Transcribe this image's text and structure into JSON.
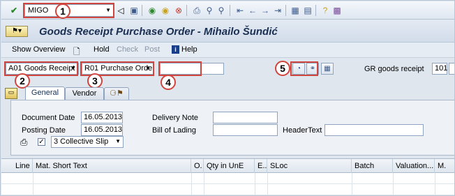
{
  "toolbar": {
    "command_value": "MIGO",
    "icons": [
      "check-icon",
      "save-icon",
      "back-icon",
      "exit-icon",
      "cancel-icon",
      "print-icon",
      "find-icon",
      "find-next-icon",
      "first-page-icon",
      "prev-page-icon",
      "next-page-icon",
      "last-page-icon",
      "new-session-icon",
      "shortcut-icon",
      "help-icon",
      "layout-icon"
    ]
  },
  "title": "Goods Receipt Purchase Order - Mihailo Šundić",
  "app_toolbar": {
    "show_overview": "Show Overview",
    "hold": "Hold",
    "check": "Check",
    "post": "Post",
    "help": "Help"
  },
  "header": {
    "action": "A01 Goods Receipt",
    "reference": "R01 Purchase Order",
    "po_number": "",
    "movement_label": "GR goods receipt",
    "movement_type": "101"
  },
  "annotations": [
    "1",
    "2",
    "3",
    "4",
    "5"
  ],
  "tabs": [
    "General",
    "Vendor"
  ],
  "general": {
    "document_date_label": "Document Date",
    "document_date": "16.05.2013",
    "posting_date_label": "Posting Date",
    "posting_date": "16.05.2013",
    "delivery_note_label": "Delivery Note",
    "delivery_note": "",
    "bill_of_lading_label": "Bill of Lading",
    "bill_of_lading": "",
    "header_text_label": "HeaderText",
    "header_text": "",
    "slip_checked": true,
    "slip_option": "3 Collective Slip"
  },
  "table": {
    "columns": [
      "Line",
      "Mat. Short Text",
      "O.",
      "Qty in UnE",
      "E..",
      "SLoc",
      "Batch",
      "Valuation...",
      "M."
    ]
  },
  "colors": {
    "annotation_red": "#d0453d",
    "title_blue": "#1a2f52"
  }
}
